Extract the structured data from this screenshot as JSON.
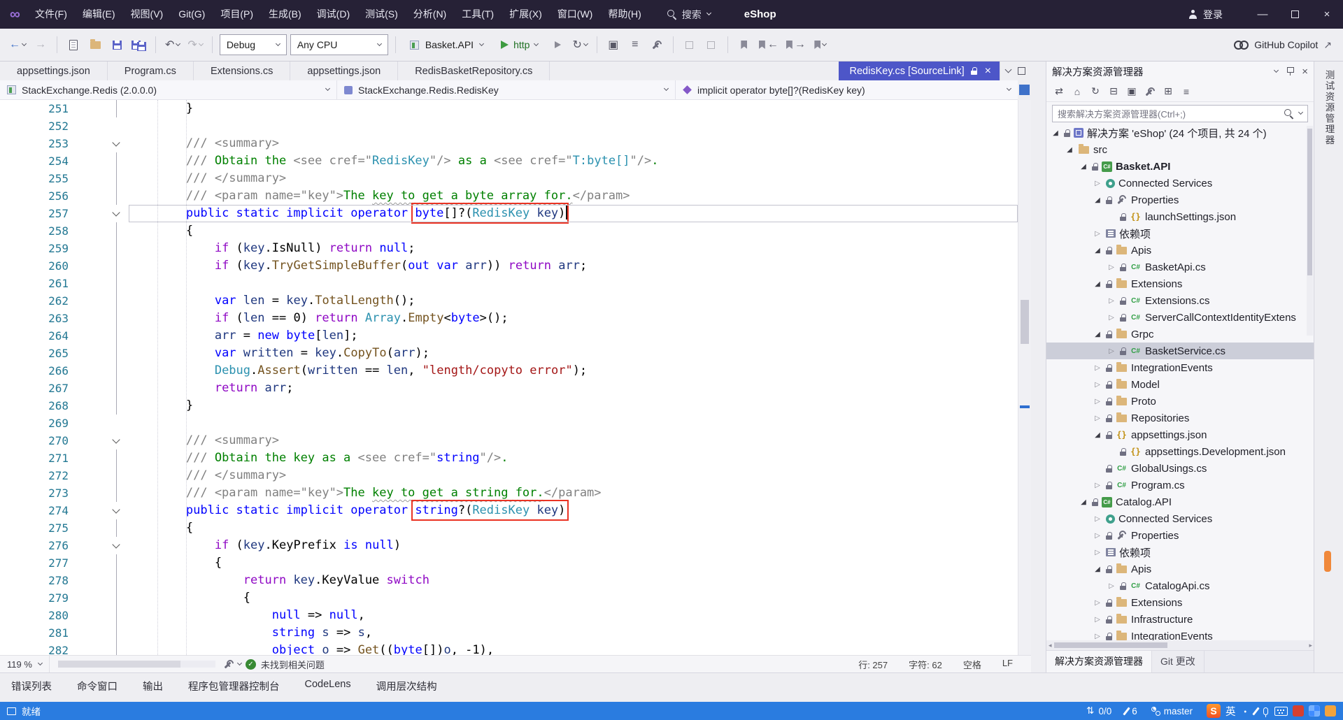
{
  "window": {
    "title": "eShop",
    "menus": [
      "文件(F)",
      "编辑(E)",
      "视图(V)",
      "Git(G)",
      "项目(P)",
      "生成(B)",
      "调试(D)",
      "测试(S)",
      "分析(N)",
      "工具(T)",
      "扩展(X)",
      "窗口(W)",
      "帮助(H)"
    ],
    "search_label": "搜索",
    "signin": "登录"
  },
  "toolbar": {
    "debug_target": "Debug",
    "platform": "Any CPU",
    "project": "Basket.API",
    "profile": "http",
    "copilot": "GitHub Copilot"
  },
  "tabs": {
    "items": [
      "appsettings.json",
      "Program.cs",
      "Extensions.cs",
      "appsettings.json",
      "RedisBasketRepository.cs"
    ],
    "active": {
      "label": "RedisKey.cs [SourceLink]"
    }
  },
  "breadcrumb": {
    "assembly": "StackExchange.Redis (2.0.0.0)",
    "type": "StackExchange.Redis.RedisKey",
    "member": "implicit operator byte[]?(RedisKey key)"
  },
  "editor": {
    "lines": [
      {
        "n": 251,
        "o": "l",
        "t": [
          [
            "d",
            "        }"
          ]
        ]
      },
      {
        "n": 252,
        "o": "",
        "t": []
      },
      {
        "n": 253,
        "o": "c",
        "t": [
          [
            "g",
            "        /// <summary>"
          ]
        ]
      },
      {
        "n": 254,
        "o": "l",
        "t": [
          [
            "g",
            "        /// "
          ],
          [
            "e",
            "Obtain the "
          ],
          [
            "g",
            "<see cref=\""
          ],
          [
            "t",
            "RedisKey"
          ],
          [
            "g",
            "\"/>"
          ],
          [
            "e",
            " as a "
          ],
          [
            "g",
            "<see cref=\""
          ],
          [
            "t",
            "T:byte[]"
          ],
          [
            "g",
            "\"/>"
          ],
          [
            "e",
            "."
          ]
        ]
      },
      {
        "n": 255,
        "o": "l",
        "t": [
          [
            "g",
            "        /// </summary>"
          ]
        ]
      },
      {
        "n": 256,
        "o": "l",
        "t": [
          [
            "g",
            "        /// <param name=\"key\">"
          ],
          [
            "e",
            "The "
          ],
          [
            "w",
            "key to get a byte array for."
          ],
          [
            "g",
            "</param>"
          ]
        ]
      },
      {
        "n": 257,
        "o": "c",
        "cur": true,
        "caret": true,
        "box": [
          2,
          7
        ],
        "t": [
          [
            "d",
            "        "
          ],
          [
            "k",
            "public static implicit operator "
          ],
          [
            "k",
            "byte"
          ],
          [
            "d",
            "[]?("
          ],
          [
            "t",
            "RedisKey"
          ],
          [
            "d",
            " "
          ],
          [
            "v",
            "key"
          ],
          [
            "d",
            ")"
          ]
        ]
      },
      {
        "n": 258,
        "o": "l",
        "t": [
          [
            "d",
            "        {"
          ]
        ]
      },
      {
        "n": 259,
        "o": "l",
        "t": [
          [
            "d",
            "            "
          ],
          [
            "c",
            "if"
          ],
          [
            "d",
            " ("
          ],
          [
            "v",
            "key"
          ],
          [
            "d",
            "."
          ],
          [
            "d",
            "IsNull"
          ],
          [
            "d",
            ") "
          ],
          [
            "c",
            "return"
          ],
          [
            "d",
            " "
          ],
          [
            "k",
            "null"
          ],
          [
            "d",
            ";"
          ]
        ]
      },
      {
        "n": 260,
        "o": "l",
        "t": [
          [
            "d",
            "            "
          ],
          [
            "c",
            "if"
          ],
          [
            "d",
            " ("
          ],
          [
            "v",
            "key"
          ],
          [
            "d",
            "."
          ],
          [
            "m",
            "TryGetSimpleBuffer"
          ],
          [
            "d",
            "("
          ],
          [
            "k",
            "out"
          ],
          [
            "d",
            " "
          ],
          [
            "k",
            "var"
          ],
          [
            "d",
            " "
          ],
          [
            "v",
            "arr"
          ],
          [
            "d",
            ")) "
          ],
          [
            "c",
            "return"
          ],
          [
            "d",
            " "
          ],
          [
            "v",
            "arr"
          ],
          [
            "d",
            ";"
          ]
        ]
      },
      {
        "n": 261,
        "o": "l",
        "t": []
      },
      {
        "n": 262,
        "o": "l",
        "t": [
          [
            "d",
            "            "
          ],
          [
            "k",
            "var"
          ],
          [
            "d",
            " "
          ],
          [
            "v",
            "len"
          ],
          [
            "d",
            " = "
          ],
          [
            "v",
            "key"
          ],
          [
            "d",
            "."
          ],
          [
            "m",
            "TotalLength"
          ],
          [
            "d",
            "();"
          ]
        ]
      },
      {
        "n": 263,
        "o": "l",
        "t": [
          [
            "d",
            "            "
          ],
          [
            "c",
            "if"
          ],
          [
            "d",
            " ("
          ],
          [
            "v",
            "len"
          ],
          [
            "d",
            " == 0) "
          ],
          [
            "c",
            "return"
          ],
          [
            "d",
            " "
          ],
          [
            "t",
            "Array"
          ],
          [
            "d",
            "."
          ],
          [
            "m",
            "Empty"
          ],
          [
            "d",
            "<"
          ],
          [
            "k",
            "byte"
          ],
          [
            "d",
            ">();"
          ]
        ]
      },
      {
        "n": 264,
        "o": "l",
        "t": [
          [
            "d",
            "            "
          ],
          [
            "v",
            "arr"
          ],
          [
            "d",
            " = "
          ],
          [
            "k",
            "new"
          ],
          [
            "d",
            " "
          ],
          [
            "k",
            "byte"
          ],
          [
            "d",
            "["
          ],
          [
            "v",
            "len"
          ],
          [
            "d",
            "];"
          ]
        ]
      },
      {
        "n": 265,
        "o": "l",
        "t": [
          [
            "d",
            "            "
          ],
          [
            "k",
            "var"
          ],
          [
            "d",
            " "
          ],
          [
            "v",
            "written"
          ],
          [
            "d",
            " = "
          ],
          [
            "v",
            "key"
          ],
          [
            "d",
            "."
          ],
          [
            "m",
            "CopyTo"
          ],
          [
            "d",
            "("
          ],
          [
            "v",
            "arr"
          ],
          [
            "d",
            ");"
          ]
        ]
      },
      {
        "n": 266,
        "o": "l",
        "t": [
          [
            "d",
            "            "
          ],
          [
            "t",
            "Debug"
          ],
          [
            "d",
            "."
          ],
          [
            "m",
            "Assert"
          ],
          [
            "d",
            "("
          ],
          [
            "v",
            "written"
          ],
          [
            "d",
            " == "
          ],
          [
            "v",
            "len"
          ],
          [
            "d",
            ", "
          ],
          [
            "s",
            "\"length/copyto error\""
          ],
          [
            "d",
            ");"
          ]
        ]
      },
      {
        "n": 267,
        "o": "l",
        "t": [
          [
            "d",
            "            "
          ],
          [
            "c",
            "return"
          ],
          [
            "d",
            " "
          ],
          [
            "v",
            "arr"
          ],
          [
            "d",
            ";"
          ]
        ]
      },
      {
        "n": 268,
        "o": "l",
        "t": [
          [
            "d",
            "        }"
          ]
        ]
      },
      {
        "n": 269,
        "o": "",
        "t": []
      },
      {
        "n": 270,
        "o": "c",
        "t": [
          [
            "g",
            "        /// <summary>"
          ]
        ]
      },
      {
        "n": 271,
        "o": "l",
        "t": [
          [
            "g",
            "        /// "
          ],
          [
            "e",
            "Obtain the key as a "
          ],
          [
            "g",
            "<see cref=\""
          ],
          [
            "k",
            "string"
          ],
          [
            "g",
            "\"/>"
          ],
          [
            "e",
            "."
          ]
        ]
      },
      {
        "n": 272,
        "o": "l",
        "t": [
          [
            "g",
            "        /// </summary>"
          ]
        ]
      },
      {
        "n": 273,
        "o": "l",
        "t": [
          [
            "g",
            "        /// <param name=\"key\">"
          ],
          [
            "e",
            "The "
          ],
          [
            "w",
            "key to get a string for."
          ],
          [
            "g",
            "</param>"
          ]
        ]
      },
      {
        "n": 274,
        "o": "c",
        "box": [
          2,
          7
        ],
        "t": [
          [
            "d",
            "        "
          ],
          [
            "k",
            "public static implicit operator "
          ],
          [
            "k",
            "string"
          ],
          [
            "d",
            "?("
          ],
          [
            "t",
            "RedisKey"
          ],
          [
            "d",
            " "
          ],
          [
            "v",
            "key"
          ],
          [
            "d",
            ")"
          ]
        ]
      },
      {
        "n": 275,
        "o": "l",
        "t": [
          [
            "d",
            "        {"
          ]
        ]
      },
      {
        "n": 276,
        "o": "c",
        "t": [
          [
            "d",
            "            "
          ],
          [
            "c",
            "if"
          ],
          [
            "d",
            " ("
          ],
          [
            "v",
            "key"
          ],
          [
            "d",
            "."
          ],
          [
            "d",
            "KeyPrefix"
          ],
          [
            "d",
            " "
          ],
          [
            "k",
            "is"
          ],
          [
            "d",
            " "
          ],
          [
            "k",
            "null"
          ],
          [
            "d",
            ")"
          ]
        ]
      },
      {
        "n": 277,
        "o": "l",
        "t": [
          [
            "d",
            "            {"
          ]
        ]
      },
      {
        "n": 278,
        "o": "l",
        "t": [
          [
            "d",
            "                "
          ],
          [
            "c",
            "return"
          ],
          [
            "d",
            " "
          ],
          [
            "v",
            "key"
          ],
          [
            "d",
            "."
          ],
          [
            "d",
            "KeyValue"
          ],
          [
            "d",
            " "
          ],
          [
            "c",
            "switch"
          ]
        ]
      },
      {
        "n": 279,
        "o": "l",
        "t": [
          [
            "d",
            "                {"
          ]
        ]
      },
      {
        "n": 280,
        "o": "l",
        "t": [
          [
            "d",
            "                    "
          ],
          [
            "k",
            "null"
          ],
          [
            "d",
            " => "
          ],
          [
            "k",
            "null"
          ],
          [
            "d",
            ","
          ]
        ]
      },
      {
        "n": 281,
        "o": "l",
        "t": [
          [
            "d",
            "                    "
          ],
          [
            "k",
            "string"
          ],
          [
            "d",
            " "
          ],
          [
            "v",
            "s"
          ],
          [
            "d",
            " => "
          ],
          [
            "v",
            "s"
          ],
          [
            "d",
            ","
          ]
        ]
      },
      {
        "n": 282,
        "o": "l",
        "t": [
          [
            "d",
            "                    "
          ],
          [
            "k",
            "object"
          ],
          [
            "d",
            " "
          ],
          [
            "v",
            "o"
          ],
          [
            "d",
            " => "
          ],
          [
            "m",
            "Get"
          ],
          [
            "d",
            "(("
          ],
          [
            "k",
            "byte"
          ],
          [
            "d",
            "[])"
          ],
          [
            "v",
            "o"
          ],
          [
            "d",
            ", -1),"
          ]
        ]
      }
    ]
  },
  "solution_explorer": {
    "title": "解决方案资源管理器",
    "search_placeholder": "搜索解决方案资源管理器(Ctrl+;)",
    "items": [
      {
        "d": 0,
        "e": "o",
        "l": true,
        "i": "sln",
        "t": "解决方案 'eShop' (24 个项目, 共 24 个)"
      },
      {
        "d": 1,
        "e": "o",
        "l": false,
        "i": "folder",
        "t": "src"
      },
      {
        "d": 2,
        "e": "o",
        "l": true,
        "i": "proj",
        "t": "Basket.API",
        "b": true
      },
      {
        "d": 3,
        "e": "c",
        "l": false,
        "i": "svc",
        "t": "Connected Services"
      },
      {
        "d": 3,
        "e": "o",
        "l": true,
        "i": "props",
        "t": "Properties"
      },
      {
        "d": 4,
        "e": "",
        "l": true,
        "i": "json",
        "t": "launchSettings.json"
      },
      {
        "d": 3,
        "e": "c",
        "l": false,
        "i": "deps",
        "t": "依赖项"
      },
      {
        "d": 3,
        "e": "o",
        "l": true,
        "i": "folder",
        "t": "Apis"
      },
      {
        "d": 4,
        "e": "c",
        "l": true,
        "i": "cs",
        "t": "BasketApi.cs"
      },
      {
        "d": 3,
        "e": "o",
        "l": true,
        "i": "folder",
        "t": "Extensions"
      },
      {
        "d": 4,
        "e": "c",
        "l": true,
        "i": "cs",
        "t": "Extensions.cs"
      },
      {
        "d": 4,
        "e": "c",
        "l": true,
        "i": "cs",
        "t": "ServerCallContextIdentityExtens"
      },
      {
        "d": 3,
        "e": "o",
        "l": true,
        "i": "folder",
        "t": "Grpc"
      },
      {
        "d": 4,
        "e": "c",
        "l": true,
        "i": "cs",
        "t": "BasketService.cs",
        "sel": true
      },
      {
        "d": 3,
        "e": "c",
        "l": true,
        "i": "folder",
        "t": "IntegrationEvents"
      },
      {
        "d": 3,
        "e": "c",
        "l": true,
        "i": "folder",
        "t": "Model"
      },
      {
        "d": 3,
        "e": "c",
        "l": true,
        "i": "folder",
        "t": "Proto"
      },
      {
        "d": 3,
        "e": "c",
        "l": true,
        "i": "folder",
        "t": "Repositories"
      },
      {
        "d": 3,
        "e": "o",
        "l": true,
        "i": "json",
        "t": "appsettings.json"
      },
      {
        "d": 4,
        "e": "",
        "l": true,
        "i": "json",
        "t": "appsettings.Development.json"
      },
      {
        "d": 3,
        "e": "",
        "l": true,
        "i": "cs",
        "t": "GlobalUsings.cs"
      },
      {
        "d": 3,
        "e": "c",
        "l": true,
        "i": "cs",
        "t": "Program.cs"
      },
      {
        "d": 2,
        "e": "o",
        "l": true,
        "i": "proj",
        "t": "Catalog.API"
      },
      {
        "d": 3,
        "e": "c",
        "l": false,
        "i": "svc",
        "t": "Connected Services"
      },
      {
        "d": 3,
        "e": "c",
        "l": true,
        "i": "props",
        "t": "Properties"
      },
      {
        "d": 3,
        "e": "c",
        "l": false,
        "i": "deps",
        "t": "依赖项"
      },
      {
        "d": 3,
        "e": "o",
        "l": true,
        "i": "folder",
        "t": "Apis"
      },
      {
        "d": 4,
        "e": "c",
        "l": true,
        "i": "cs",
        "t": "CatalogApi.cs"
      },
      {
        "d": 3,
        "e": "c",
        "l": true,
        "i": "folder",
        "t": "Extensions"
      },
      {
        "d": 3,
        "e": "c",
        "l": true,
        "i": "folder",
        "t": "Infrastructure"
      },
      {
        "d": 3,
        "e": "c",
        "l": true,
        "i": "folder",
        "t": "IntegrationEvents"
      }
    ],
    "bottom_tabs": [
      "解决方案资源管理器",
      "Git 更改"
    ]
  },
  "right_strip": {
    "tabs": [
      "测试资源管理器"
    ]
  },
  "zoom_bar": {
    "zoom": "119 %",
    "health": "未找到相关问题",
    "line_label": "行: 257",
    "col_label": "字符: 62",
    "spaces_label": "空格",
    "eol_label": "LF"
  },
  "panel_tabs": [
    "错误列表",
    "命令窗口",
    "输出",
    "程序包管理器控制台",
    "CodeLens",
    "调用层次结构"
  ],
  "status_bar": {
    "ready": "就绪",
    "sync": "0/0",
    "edits": "6",
    "branch": "master",
    "ime": {
      "logo": "S",
      "lang": "英",
      "dot": "・"
    }
  },
  "colors": {
    "accent_tab": "#4d56c8",
    "status_bar": "#2a7ce0",
    "annotation": "#ea3323"
  }
}
